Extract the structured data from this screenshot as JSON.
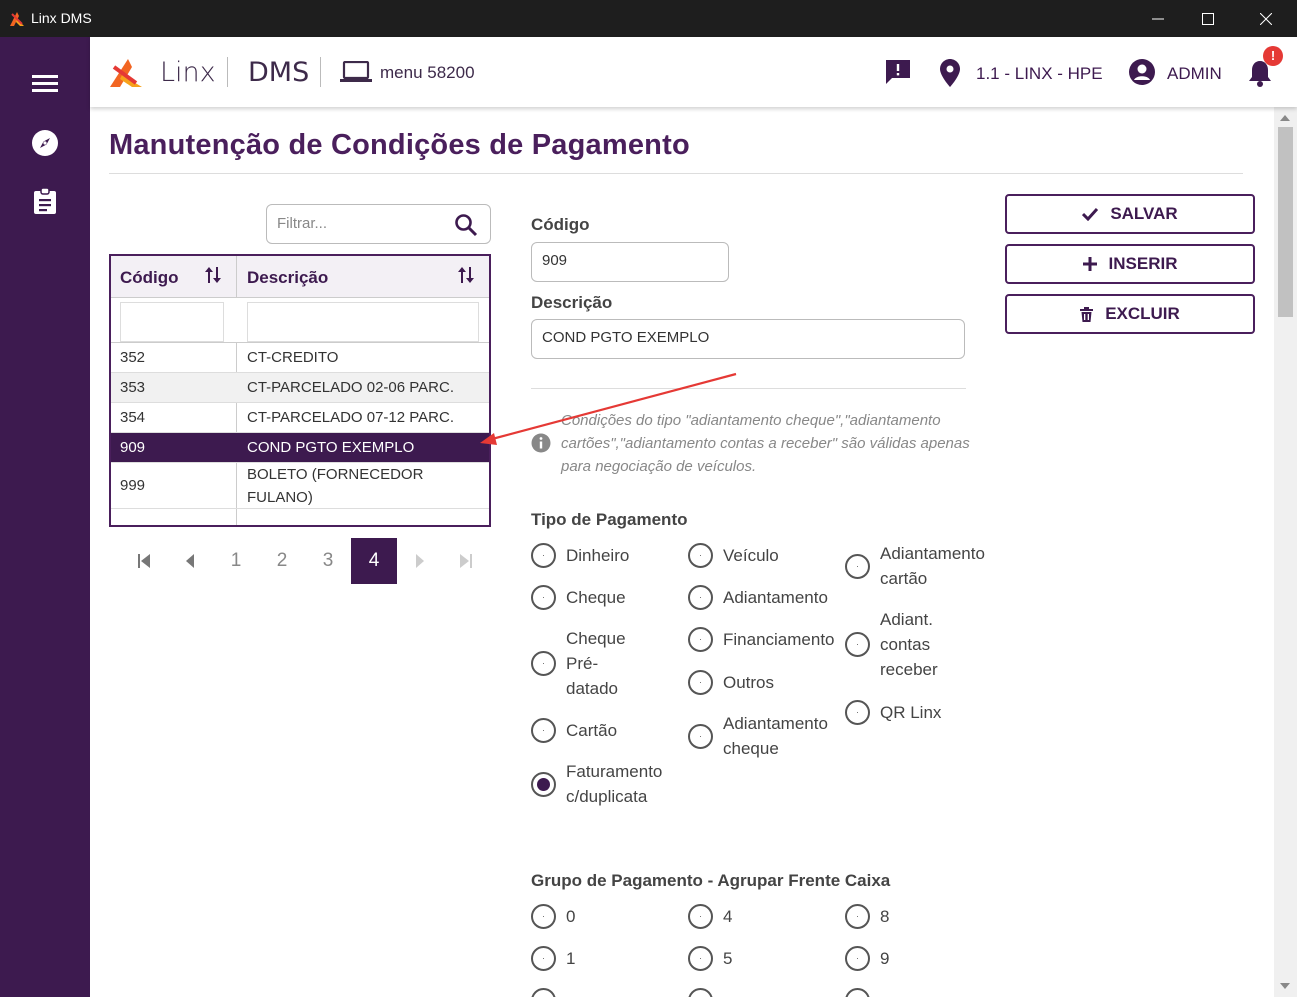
{
  "window": {
    "title": "Linx DMS"
  },
  "header": {
    "brand": "Linx",
    "product": "DMS",
    "menu_label": "menu 58200",
    "branch": "1.1 - LINX - HPE",
    "user": "ADMIN",
    "notification_badge": "!"
  },
  "page": {
    "title": "Manutenção de Condições de Pagamento"
  },
  "filter": {
    "placeholder": "Filtrar..."
  },
  "grid": {
    "columns": [
      "Código",
      "Descrição"
    ],
    "rows": [
      {
        "code": "352",
        "description": "CT-CREDITO"
      },
      {
        "code": "353",
        "description": "CT-PARCELADO 02-06 PARC."
      },
      {
        "code": "354",
        "description": "CT-PARCELADO 07-12 PARC."
      },
      {
        "code": "909",
        "description": "COND PGTO EXEMPLO"
      },
      {
        "code": "999",
        "description": "BOLETO (FORNECEDOR FULANO)"
      }
    ],
    "selected_code": "909"
  },
  "pagination": {
    "pages": [
      "1",
      "2",
      "3",
      "4"
    ],
    "current": "4"
  },
  "form": {
    "code_label": "Código",
    "code_value": "909",
    "description_label": "Descrição",
    "description_value": "COND PGTO EXEMPLO",
    "info_text": "Condições do tipo \"adiantamento cheque\",\"adiantamento cartões\",\"adiantamento contas a receber\" são válidas apenas para negociação de veículos.",
    "payment_type_label": "Tipo de Pagamento",
    "payment_types": [
      "Dinheiro",
      "Cheque",
      "Cheque Pré-datado",
      "Cartão",
      "Faturamento c/duplicata",
      "Veículo",
      "Adiantamento",
      "Financiamento",
      "Outros",
      "Adiantamento cheque",
      "Adiantamento cartão",
      "Adiant. contas receber",
      "QR Linx"
    ],
    "payment_type_selected": "Faturamento c/duplicata",
    "group_label": "Grupo de Pagamento - Agrupar Frente Caixa",
    "groups": [
      "0",
      "1",
      "4",
      "5",
      "8",
      "9"
    ]
  },
  "actions": {
    "save": "SALVAR",
    "insert": "INSERIR",
    "delete": "EXCLUIR"
  },
  "colors": {
    "primary": "#3d1a4f",
    "accent": "#e53935"
  }
}
